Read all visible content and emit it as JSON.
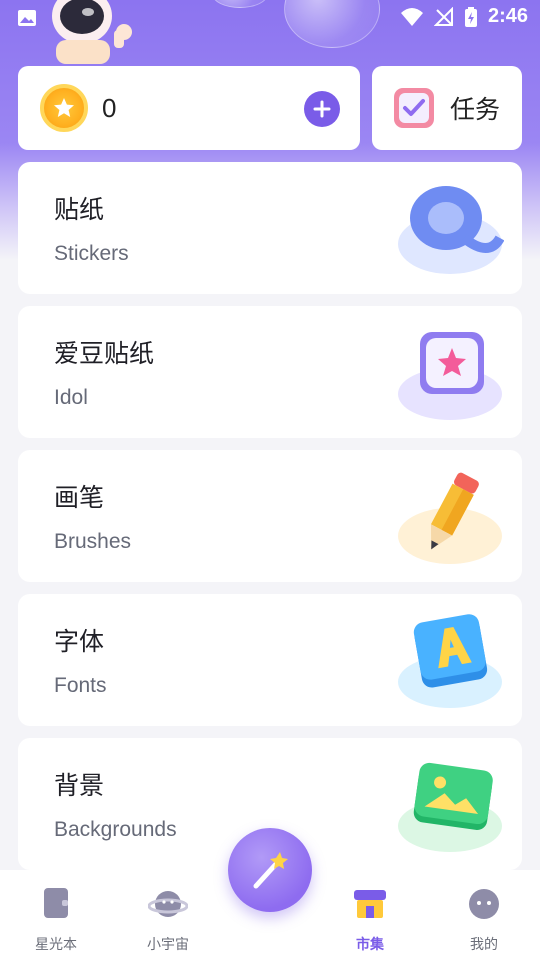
{
  "status_bar": {
    "time": "2:46",
    "icons": [
      "image-icon",
      "wifi-icon",
      "no-signal-icon",
      "battery-charging-icon"
    ]
  },
  "wallet": {
    "coin_count": "0",
    "icon": "star-coin-icon",
    "add_icon": "plus-icon"
  },
  "task": {
    "label": "任务",
    "icon": "checkbox-icon"
  },
  "categories": [
    {
      "title": "贴纸",
      "subtitle": "Stickers",
      "icon": "ribbon-ring-icon"
    },
    {
      "title": "爱豆贴纸",
      "subtitle": "Idol",
      "icon": "star-tile-icon"
    },
    {
      "title": "画笔",
      "subtitle": "Brushes",
      "icon": "pencil-icon"
    },
    {
      "title": "字体",
      "subtitle": "Fonts",
      "icon": "letter-a-tile-icon"
    },
    {
      "title": "背景",
      "subtitle": "Backgrounds",
      "icon": "picture-icon"
    }
  ],
  "bottom_nav": {
    "items": [
      {
        "label": "星光本",
        "icon": "notebook-icon",
        "active": false
      },
      {
        "label": "小宇宙",
        "icon": "planet-icon",
        "active": false
      },
      {
        "label": "市集",
        "icon": "shop-icon",
        "active": true
      },
      {
        "label": "我的",
        "icon": "profile-face-icon",
        "active": false
      }
    ],
    "center_icon": "magic-wand-icon"
  },
  "colors": {
    "accent": "#7a5ce8",
    "hero_top": "#8c74f0",
    "background": "#f4f4f8"
  }
}
